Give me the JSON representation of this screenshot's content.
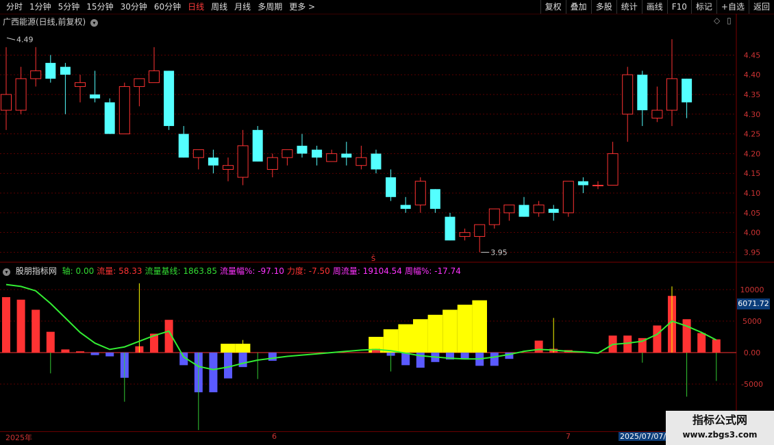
{
  "toolbar": {
    "periods": [
      "分时",
      "1分钟",
      "5分钟",
      "15分钟",
      "30分钟",
      "60分钟",
      "日线",
      "周线",
      "月线",
      "多周期",
      "更多 >"
    ],
    "active_period": "日线",
    "actions": [
      "复权",
      "叠加",
      "多股",
      "统计",
      "画线",
      "F10",
      "标记",
      "+自选",
      "返回"
    ]
  },
  "main_pane": {
    "title": "广西能源(日线,前复权)",
    "high_label": "4.49",
    "low_label": "3.95",
    "price_ticks": [
      "4.45",
      "4.40",
      "4.35",
      "4.30",
      "4.25",
      "4.20",
      "4.15",
      "4.10",
      "4.05",
      "4.00",
      "3.95"
    ]
  },
  "indicator_pane": {
    "name": "股朋指标网",
    "items": [
      {
        "label": "轴:",
        "value": "0.00",
        "color": "#33dd33"
      },
      {
        "label": "流量:",
        "value": "58.33",
        "color": "#ff3333"
      },
      {
        "label": "流量基线:",
        "value": "1863.85",
        "color": "#33dd33"
      },
      {
        "label": "流量幅%:",
        "value": "-97.10",
        "color": "#ff33ff"
      },
      {
        "label": "力度:",
        "value": "-7.50",
        "color": "#ff3333"
      },
      {
        "label": "周流量:",
        "value": "19104.54",
        "color": "#ff33ff"
      },
      {
        "label": "周幅%:",
        "value": "-17.74",
        "color": "#ff33ff"
      }
    ],
    "ticks": [
      "10000",
      "5000",
      "0.00",
      "-5000"
    ],
    "current_value": "6071.72"
  },
  "date_axis": {
    "labels": [
      "2025年",
      "6",
      "7",
      "2025/07/07/"
    ]
  },
  "watermark": {
    "line1": "指标公式网",
    "line2": "www.zbgs3.com"
  },
  "chart_data": [
    {
      "type": "candlestick",
      "title": "广西能源(日线,前复权)",
      "ylim": [
        3.93,
        4.52
      ],
      "candles": [
        {
          "o": 4.31,
          "h": 4.47,
          "l": 4.26,
          "c": 4.35
        },
        {
          "o": 4.31,
          "h": 4.42,
          "l": 4.3,
          "c": 4.39
        },
        {
          "o": 4.39,
          "h": 4.47,
          "l": 4.37,
          "c": 4.41
        },
        {
          "o": 4.43,
          "h": 4.45,
          "l": 4.38,
          "c": 4.39
        },
        {
          "o": 4.42,
          "h": 4.43,
          "l": 4.3,
          "c": 4.4
        },
        {
          "o": 4.37,
          "h": 4.4,
          "l": 4.33,
          "c": 4.38
        },
        {
          "o": 4.35,
          "h": 4.41,
          "l": 4.33,
          "c": 4.34
        },
        {
          "o": 4.33,
          "h": 4.34,
          "l": 4.25,
          "c": 4.25
        },
        {
          "o": 4.25,
          "h": 4.38,
          "l": 4.25,
          "c": 4.37
        },
        {
          "o": 4.37,
          "h": 4.39,
          "l": 4.32,
          "c": 4.39
        },
        {
          "o": 4.38,
          "h": 4.47,
          "l": 4.38,
          "c": 4.41
        },
        {
          "o": 4.41,
          "h": 4.41,
          "l": 4.26,
          "c": 4.27
        },
        {
          "o": 4.25,
          "h": 4.27,
          "l": 4.19,
          "c": 4.19
        },
        {
          "o": 4.19,
          "h": 4.21,
          "l": 4.16,
          "c": 4.21
        },
        {
          "o": 4.19,
          "h": 4.21,
          "l": 4.15,
          "c": 4.17
        },
        {
          "o": 4.16,
          "h": 4.19,
          "l": 4.13,
          "c": 4.17
        },
        {
          "o": 4.14,
          "h": 4.26,
          "l": 4.12,
          "c": 4.22
        },
        {
          "o": 4.26,
          "h": 4.27,
          "l": 4.18,
          "c": 4.18
        },
        {
          "o": 4.16,
          "h": 4.2,
          "l": 4.14,
          "c": 4.19
        },
        {
          "o": 4.19,
          "h": 4.21,
          "l": 4.17,
          "c": 4.21
        },
        {
          "o": 4.22,
          "h": 4.25,
          "l": 4.19,
          "c": 4.2
        },
        {
          "o": 4.21,
          "h": 4.22,
          "l": 4.17,
          "c": 4.19
        },
        {
          "o": 4.18,
          "h": 4.21,
          "l": 4.18,
          "c": 4.2
        },
        {
          "o": 4.2,
          "h": 4.23,
          "l": 4.17,
          "c": 4.19
        },
        {
          "o": 4.17,
          "h": 4.22,
          "l": 4.16,
          "c": 4.19
        },
        {
          "o": 4.2,
          "h": 4.21,
          "l": 4.15,
          "c": 4.16
        },
        {
          "o": 4.14,
          "h": 4.16,
          "l": 4.08,
          "c": 4.09
        },
        {
          "o": 4.07,
          "h": 4.09,
          "l": 4.05,
          "c": 4.06
        },
        {
          "o": 4.07,
          "h": 4.14,
          "l": 4.05,
          "c": 4.13
        },
        {
          "o": 4.11,
          "h": 4.11,
          "l": 4.05,
          "c": 4.06
        },
        {
          "o": 4.04,
          "h": 4.05,
          "l": 3.98,
          "c": 3.98
        },
        {
          "o": 3.99,
          "h": 4.01,
          "l": 3.98,
          "c": 4.0
        },
        {
          "o": 3.99,
          "h": 4.02,
          "l": 3.95,
          "c": 4.02
        },
        {
          "o": 4.02,
          "h": 4.06,
          "l": 4.01,
          "c": 4.06
        },
        {
          "o": 4.05,
          "h": 4.07,
          "l": 4.03,
          "c": 4.07
        },
        {
          "o": 4.07,
          "h": 4.09,
          "l": 4.04,
          "c": 4.04
        },
        {
          "o": 4.05,
          "h": 4.08,
          "l": 4.04,
          "c": 4.07
        },
        {
          "o": 4.06,
          "h": 4.07,
          "l": 4.03,
          "c": 4.05
        },
        {
          "o": 4.05,
          "h": 4.13,
          "l": 4.04,
          "c": 4.13
        },
        {
          "o": 4.13,
          "h": 4.14,
          "l": 4.1,
          "c": 4.12
        },
        {
          "o": 4.12,
          "h": 4.13,
          "l": 4.11,
          "c": 4.12
        },
        {
          "o": 4.12,
          "h": 4.23,
          "l": 4.12,
          "c": 4.2
        },
        {
          "o": 4.3,
          "h": 4.42,
          "l": 4.23,
          "c": 4.4
        },
        {
          "o": 4.4,
          "h": 4.41,
          "l": 4.27,
          "c": 4.31
        },
        {
          "o": 4.29,
          "h": 4.37,
          "l": 4.28,
          "c": 4.31
        },
        {
          "o": 4.31,
          "h": 4.49,
          "l": 4.27,
          "c": 4.39
        },
        {
          "o": 4.39,
          "h": 4.39,
          "l": 4.29,
          "c": 4.33
        }
      ]
    },
    {
      "type": "bar",
      "title": "股朋指标网",
      "ylim": [
        -12500,
        12500
      ],
      "flow": [
        8800,
        8400,
        6800,
        3300,
        500,
        200,
        -400,
        -600,
        -4000,
        1000,
        3000,
        5200,
        -2000,
        -6300,
        -6300,
        -4100,
        -2300,
        0,
        -1300,
        0,
        0,
        0,
        0,
        0,
        0,
        600,
        -500,
        -2000,
        -2400,
        -1500,
        -1100,
        -1100,
        -2100,
        -2100,
        -1000,
        0,
        1900,
        600,
        400,
        0,
        0,
        2700,
        2700,
        2300,
        4300,
        9000,
        5300,
        3100,
        2100
      ],
      "weekly": [
        0,
        0,
        0,
        0,
        0,
        0,
        0,
        0,
        0,
        0,
        0,
        0,
        0,
        0,
        0,
        1400,
        1400,
        0,
        0,
        0,
        0,
        0,
        0,
        0,
        0,
        2500,
        3700,
        4500,
        5300,
        6000,
        6800,
        7600,
        8300,
        0,
        0,
        0,
        0,
        0,
        0,
        0,
        0,
        0,
        0,
        0,
        0,
        0,
        0,
        0,
        0
      ],
      "baseline": [
        10800,
        10500,
        9800,
        7800,
        5500,
        3200,
        1500,
        500,
        900,
        1800,
        2700,
        3400,
        -700,
        -2200,
        -2700,
        -2300,
        -1700,
        -1200,
        -900,
        -600,
        -400,
        -200,
        0,
        200,
        400,
        500,
        300,
        -100,
        -500,
        -700,
        -900,
        -1000,
        -1000,
        -700,
        -300,
        200,
        500,
        400,
        200,
        100,
        -100,
        1300,
        1500,
        1800,
        2900,
        5000,
        4200,
        3200,
        2000
      ],
      "spikes": [
        {
          "i": 3,
          "v": -3300
        },
        {
          "i": 8,
          "v": -7800
        },
        {
          "i": 9,
          "v": 11000
        },
        {
          "i": 13,
          "v": -12300
        },
        {
          "i": 16,
          "v": 2000
        },
        {
          "i": 17,
          "v": -4200
        },
        {
          "i": 26,
          "v": -3000
        },
        {
          "i": 37,
          "v": 5500
        },
        {
          "i": 43,
          "v": -1600
        },
        {
          "i": 45,
          "v": 10500
        },
        {
          "i": 46,
          "v": -7000
        },
        {
          "i": 48,
          "v": -4500
        }
      ]
    }
  ]
}
